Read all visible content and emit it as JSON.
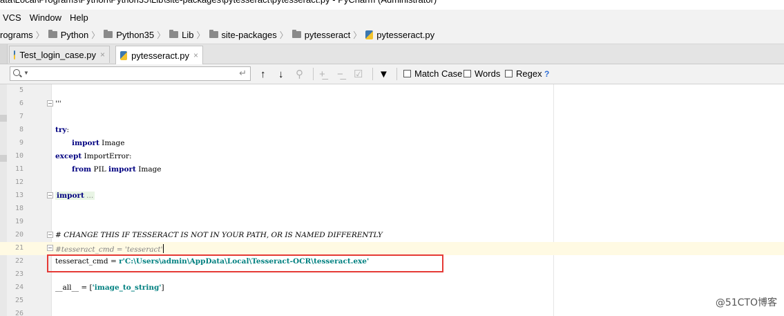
{
  "window": {
    "title": "ata\\Local\\Programs\\Python\\Python35\\Lib\\site-packages\\pytesseract\\pytesseract.py - PyCharm (Administrator)"
  },
  "menu": {
    "items": [
      "VCS",
      "Window",
      "Help"
    ]
  },
  "breadcrumb": [
    {
      "label": "rograms",
      "icon": "folder-icon"
    },
    {
      "label": "Python",
      "icon": "folder-icon"
    },
    {
      "label": "Python35",
      "icon": "folder-icon"
    },
    {
      "label": "Lib",
      "icon": "folder-icon"
    },
    {
      "label": "site-packages",
      "icon": "folder-icon"
    },
    {
      "label": "pytesseract",
      "icon": "folder-icon"
    },
    {
      "label": "pytesseract.py",
      "icon": "python-file-icon"
    }
  ],
  "tabs": [
    {
      "label": "Test_login_case.py",
      "active": false,
      "close": "×"
    },
    {
      "label": "pytesseract.py",
      "active": true,
      "close": "×"
    }
  ],
  "search": {
    "value": "",
    "placeholder": "",
    "options": {
      "match_case": "Match Case",
      "words": "Words",
      "regex": "Regex",
      "help": "?"
    }
  },
  "editor": {
    "current_line": "21",
    "lines": [
      {
        "num": "5"
      },
      {
        "num": "6"
      },
      {
        "num": "7"
      },
      {
        "num": "8"
      },
      {
        "num": "9"
      },
      {
        "num": "10"
      },
      {
        "num": "11"
      },
      {
        "num": "12"
      },
      {
        "num": "13"
      },
      {
        "num": "18"
      },
      {
        "num": "19"
      },
      {
        "num": "20"
      },
      {
        "num": "21"
      },
      {
        "num": "22"
      },
      {
        "num": "23"
      },
      {
        "num": "24"
      },
      {
        "num": "25"
      },
      {
        "num": "26"
      }
    ],
    "code": {
      "l6": "'''",
      "l8_kw": "try",
      "l8_rest": ":",
      "l9_kw": "import",
      "l9_rest": " Image",
      "l10_kw": "except",
      "l10_rest": " ImportError:",
      "l11_kw1": "from",
      "l11_mid": " PIL ",
      "l11_kw2": "import",
      "l11_rest": " Image",
      "l13_kw": "import",
      "l13_rest": " ...",
      "l20": "# CHANGE THIS IF TESSERACT IS NOT IN YOUR PATH, OR IS NAMED DIFFERENTLY",
      "l21": "#tesseract_cmd = 'tesseract'",
      "l22_pre": "tesseract_cmd = ",
      "l22_str": "r'C:\\Users\\admin\\AppData\\Local\\Tesseract-OCR\\tesseract.exe'",
      "l24_pre": "__all__ = [",
      "l24_str": "'image_to_string'",
      "l24_post": "]"
    }
  },
  "watermark": "@51CTO博客",
  "colors": {
    "keyword": "#000080",
    "comment": "#808080",
    "string": "#008080",
    "highlight_box": "#e53935",
    "current_line": "#fffae3"
  }
}
